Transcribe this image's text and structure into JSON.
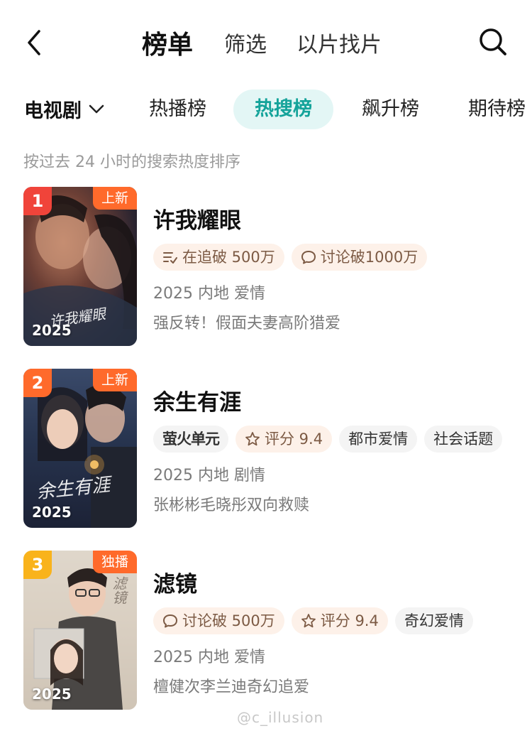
{
  "header": {
    "tabs": [
      "榜单",
      "筛选",
      "以片找片"
    ]
  },
  "category": {
    "dropdown_label": "电视剧",
    "pills": [
      "热播榜",
      "热搜榜",
      "飙升榜",
      "期待榜"
    ],
    "active_pill": "热搜榜"
  },
  "subtitle": "按过去 24 小时的搜索热度排序",
  "items": [
    {
      "rank": "1",
      "badge": "上新",
      "poster_year": "2025",
      "poster_title": "许我耀眼",
      "title": "许我耀眼",
      "tags": [
        {
          "text": "在追破 500万",
          "icon": "list-check-icon",
          "style": "warm"
        },
        {
          "text": "讨论破1000万",
          "icon": "chat-bubble-icon",
          "style": "warm"
        }
      ],
      "meta": "2025 内地 爱情",
      "desc": "强反转！假面夫妻高阶猎爱"
    },
    {
      "rank": "2",
      "badge": "上新",
      "poster_year": "2025",
      "poster_title": "余生有涯",
      "title": "余生有涯",
      "tags": [
        {
          "text": "萤火单元",
          "icon": "",
          "style": "gray"
        },
        {
          "text": "评分 9.4",
          "icon": "star-icon",
          "style": "warm"
        },
        {
          "text": "都市爱情",
          "icon": "",
          "style": "gray"
        },
        {
          "text": "社会话题",
          "icon": "",
          "style": "gray"
        }
      ],
      "meta": "2025 内地 剧情",
      "desc": "张彬彬毛晓彤双向救赎"
    },
    {
      "rank": "3",
      "badge": "独播",
      "poster_year": "2025",
      "poster_title": "滤镜",
      "title": "滤镜",
      "tags": [
        {
          "text": "讨论破 500万",
          "icon": "chat-bubble-icon",
          "style": "warm"
        },
        {
          "text": "评分 9.4",
          "icon": "star-icon",
          "style": "warm"
        },
        {
          "text": "奇幻爱情",
          "icon": "",
          "style": "gray"
        }
      ],
      "meta": "2025 内地 爱情",
      "desc": "檀健次李兰迪奇幻追爱"
    }
  ],
  "watermark": "@c_illusion",
  "colors": {
    "accent": "#14a39a",
    "accent_bg": "#e3f6f5",
    "rank1": "#f0443a",
    "rank2": "#ff6a2b",
    "rank3": "#f9b31b",
    "badge": "#ff6a2b"
  }
}
